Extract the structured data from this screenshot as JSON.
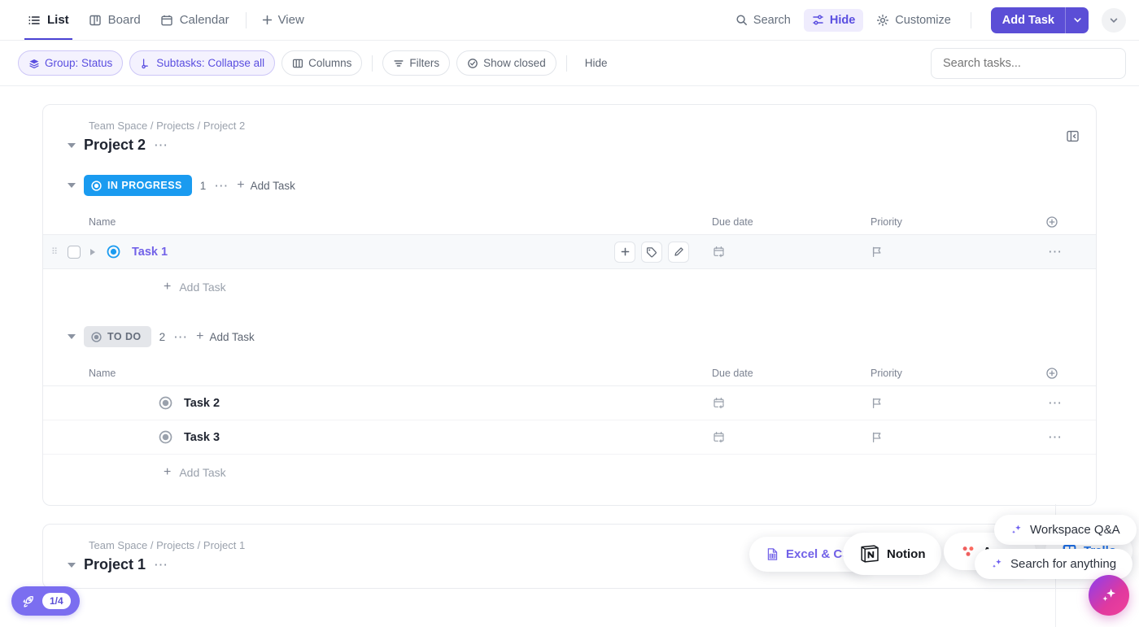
{
  "viewbar": {
    "tabs": [
      {
        "label": "List",
        "icon": "list-icon",
        "active": true
      },
      {
        "label": "Board",
        "icon": "board-icon",
        "active": false
      },
      {
        "label": "Calendar",
        "icon": "calendar-icon",
        "active": false
      }
    ],
    "add_view_label": "View",
    "search_label": "Search",
    "hide_label": "Hide",
    "customize_label": "Customize",
    "add_task_label": "Add Task"
  },
  "filterbar": {
    "chips": [
      {
        "label": "Group: Status",
        "icon": "layers-icon",
        "style": "purple"
      },
      {
        "label": "Subtasks: Collapse all",
        "icon": "subtask-icon",
        "style": "purple"
      },
      {
        "label": "Columns",
        "icon": "columns-icon",
        "style": "plain"
      },
      {
        "label": "Filters",
        "icon": "filter-icon",
        "style": "plain"
      },
      {
        "label": "Show closed",
        "icon": "check-circle-icon",
        "style": "plain"
      }
    ],
    "hide_label": "Hide",
    "search": {
      "placeholder": "Search tasks...",
      "value": ""
    }
  },
  "projects": [
    {
      "breadcrumb": "Team Space / Projects / Project 2",
      "title": "Project 2",
      "groups": [
        {
          "status": "IN PROGRESS",
          "status_style": "inprogress",
          "count": "1",
          "add_task_label": "Add Task",
          "columns": {
            "name": "Name",
            "due": "Due date",
            "priority": "Priority"
          },
          "tasks": [
            {
              "name": "Task 1",
              "highlighted": true,
              "due": "",
              "priority": ""
            }
          ],
          "footer_add_task": "Add Task"
        },
        {
          "status": "TO DO",
          "status_style": "todo",
          "count": "2",
          "add_task_label": "Add Task",
          "columns": {
            "name": "Name",
            "due": "Due date",
            "priority": "Priority"
          },
          "tasks": [
            {
              "name": "Task 2",
              "highlighted": false,
              "due": "",
              "priority": ""
            },
            {
              "name": "Task 3",
              "highlighted": false,
              "due": "",
              "priority": ""
            }
          ],
          "footer_add_task": "Add Task"
        }
      ]
    },
    {
      "breadcrumb": "Team Space / Projects / Project 1",
      "title": "Project 1",
      "groups": []
    }
  ],
  "floating": {
    "pills": [
      {
        "label": "Excel & CSV",
        "icon": "excel-icon"
      },
      {
        "label": "Notion",
        "icon": "notion-icon"
      },
      {
        "label": "Asana",
        "icon": "asana-icon"
      },
      {
        "label": "Trello",
        "icon": "trello-icon"
      }
    ],
    "tips": [
      {
        "label": "Workspace Q&A",
        "icon": "sparkle-icon"
      },
      {
        "label": "Search for anything",
        "icon": "sparkle-icon"
      }
    ],
    "ai_button": "ai-sparkle-button",
    "rocket": {
      "icon": "rocket-icon",
      "count": "1/4"
    }
  },
  "colors": {
    "accent_purple": "#5b4ed6",
    "status_in_progress": "#1a9bf0",
    "status_todo": "#e4e6ea",
    "task_link": "#7262e8"
  }
}
